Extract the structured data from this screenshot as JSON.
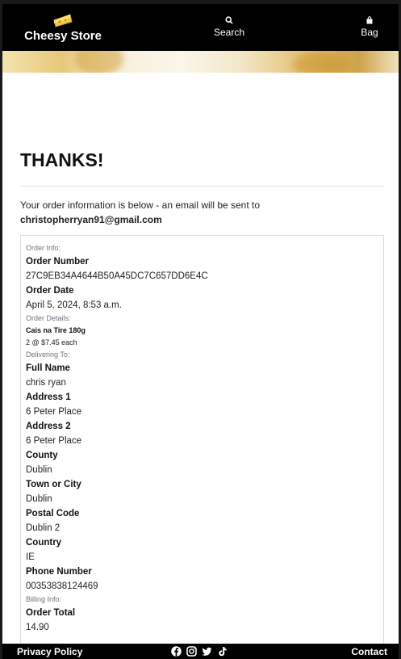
{
  "header": {
    "brand_name": "Cheesy Store",
    "search_label": "Search",
    "bag_label": "Bag"
  },
  "main": {
    "heading": "THANKS!",
    "intro_text": "Your order information is below - an email will be sent to",
    "email": "christopherryan91@gmail.com"
  },
  "order": {
    "order_info_heading": "Order Info:",
    "order_number_label": "Order Number",
    "order_number": "27C9EB34A4644B50A45DC7C657DD6E4C",
    "order_date_label": "Order Date",
    "order_date": "April 5, 2024, 8:53 a.m.",
    "order_details_heading": "Order Details:",
    "items": [
      {
        "name": "Cais na Tire 180g",
        "quantity_line": "2 @ $7.45 each"
      }
    ],
    "delivering_heading": "Delivering To:",
    "full_name_label": "Full Name",
    "full_name": "chris ryan",
    "address1_label": "Address 1",
    "address1": "6 Peter Place",
    "address2_label": "Address 2",
    "address2": "6 Peter Place",
    "county_label": "County",
    "county": "Dublin",
    "town_label": "Town or City",
    "town": "Dublin",
    "postal_label": "Postal Code",
    "postal": "Dublin 2",
    "country_label": "Country",
    "country": "IE",
    "phone_label": "Phone Number",
    "phone": "00353838124469",
    "billing_heading": "Billing Info:",
    "total_label": "Order Total",
    "total": "14.90"
  },
  "footer": {
    "privacy_label": "Privacy Policy",
    "contact_label": "Contact",
    "social_icons": [
      "facebook-icon",
      "instagram-icon",
      "twitter-icon",
      "tiktok-icon"
    ]
  }
}
